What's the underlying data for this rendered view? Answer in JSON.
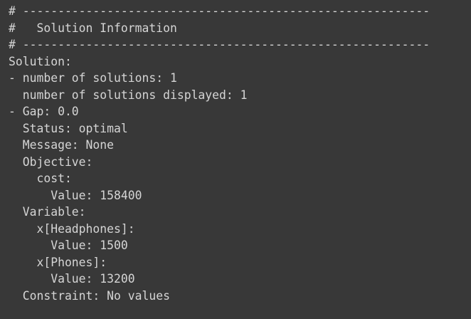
{
  "output": {
    "lines": [
      "# ----------------------------------------------------------",
      "#   Solution Information",
      "# ----------------------------------------------------------",
      "Solution:",
      "- number of solutions: 1",
      "  number of solutions displayed: 1",
      "- Gap: 0.0",
      "  Status: optimal",
      "  Message: None",
      "  Objective:",
      "    cost:",
      "      Value: 158400",
      "  Variable:",
      "    x[Headphones]:",
      "      Value: 1500",
      "    x[Phones]:",
      "      Value: 13200",
      "  Constraint: No values"
    ]
  }
}
